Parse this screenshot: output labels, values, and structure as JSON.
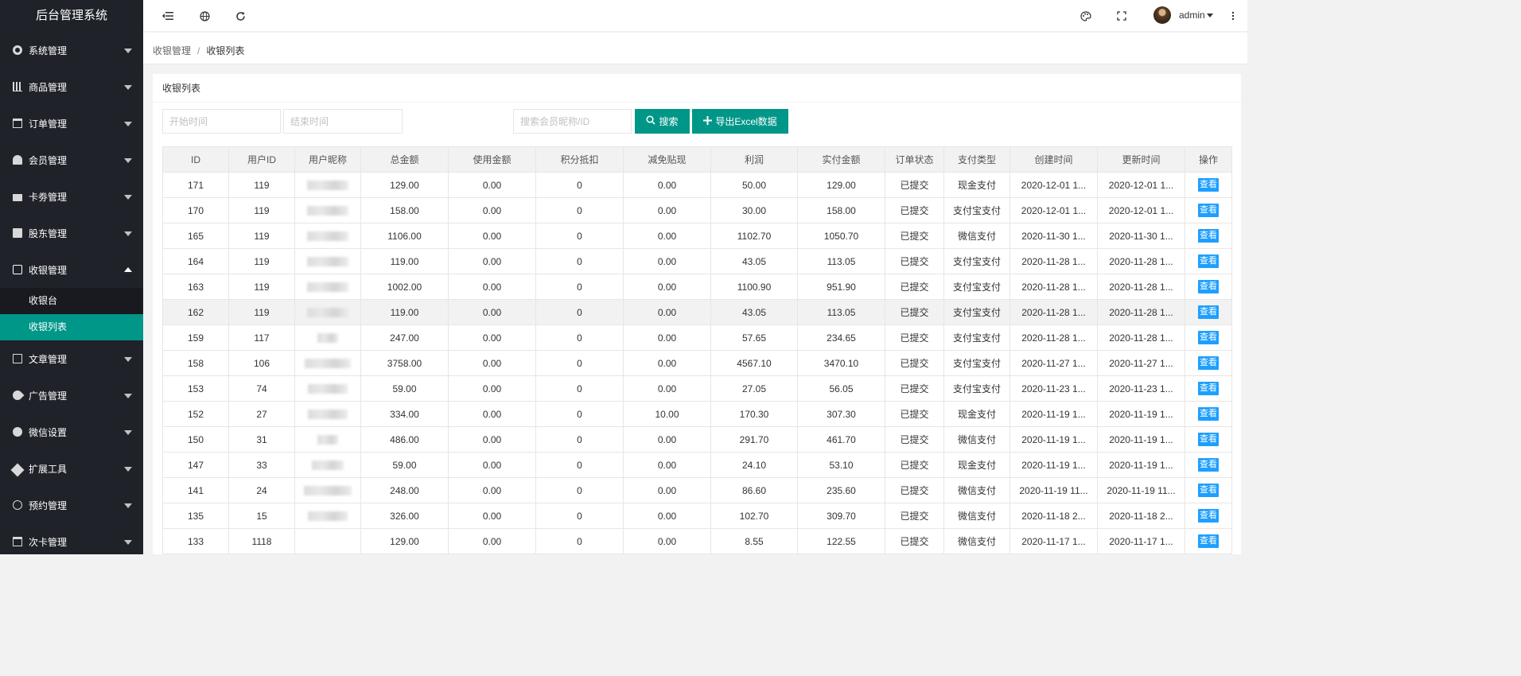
{
  "app": {
    "title": "后台管理系统"
  },
  "sidebar": {
    "items": [
      {
        "label": "系统管理",
        "icon": "gear-icon"
      },
      {
        "label": "商品管理",
        "icon": "bar-chart-icon"
      },
      {
        "label": "订单管理",
        "icon": "calendar-icon"
      },
      {
        "label": "会员管理",
        "icon": "users-icon"
      },
      {
        "label": "卡劵管理",
        "icon": "credit-card-icon"
      },
      {
        "label": "股东管理",
        "icon": "address-book-icon"
      },
      {
        "label": "收银管理",
        "icon": "check-square-icon",
        "expanded": true,
        "children": [
          {
            "label": "收银台"
          },
          {
            "label": "收银列表",
            "active": true
          }
        ]
      },
      {
        "label": "文章管理",
        "icon": "copy-icon"
      },
      {
        "label": "广告管理",
        "icon": "rocket-icon"
      },
      {
        "label": "微信设置",
        "icon": "wechat-icon"
      },
      {
        "label": "扩展工具",
        "icon": "wrench-icon"
      },
      {
        "label": "预约管理",
        "icon": "clock-icon"
      },
      {
        "label": "次卡管理",
        "icon": "calendar-icon"
      }
    ]
  },
  "header": {
    "user": "admin",
    "icons": [
      "shrink-menu-icon",
      "globe-icon",
      "refresh-icon",
      "theme-icon",
      "fullscreen-icon",
      "more-vertical-icon"
    ]
  },
  "breadcrumb": {
    "parent": "收银管理",
    "separator": "/",
    "current": "收银列表"
  },
  "card": {
    "title": "收银列表"
  },
  "filters": {
    "start_placeholder": "开始时间",
    "end_placeholder": "结束时间",
    "search_placeholder": "搜索会员昵称/ID",
    "search_label": "搜索",
    "export_label": "导出Excel数据"
  },
  "table": {
    "columns": [
      "ID",
      "用户ID",
      "用户昵称",
      "总金额",
      "使用金额",
      "积分抵扣",
      "减免贴现",
      "利润",
      "实付金额",
      "订单状态",
      "支付类型",
      "创建时间",
      "更新时间",
      "操作"
    ],
    "action_label": "查看",
    "rows": [
      {
        "id": "171",
        "uid": "119",
        "total": "129.00",
        "used": "0.00",
        "points": "0",
        "discount": "0.00",
        "profit": "50.00",
        "paid": "129.00",
        "status": "已提交",
        "pay": "现金支付",
        "created": "2020-12-01 1...",
        "updated": "2020-12-01 1..."
      },
      {
        "id": "170",
        "uid": "119",
        "total": "158.00",
        "used": "0.00",
        "points": "0",
        "discount": "0.00",
        "profit": "30.00",
        "paid": "158.00",
        "status": "已提交",
        "pay": "支付宝支付",
        "created": "2020-12-01 1...",
        "updated": "2020-12-01 1..."
      },
      {
        "id": "165",
        "uid": "119",
        "total": "1106.00",
        "used": "0.00",
        "points": "0",
        "discount": "0.00",
        "profit": "1102.70",
        "paid": "1050.70",
        "status": "已提交",
        "pay": "微信支付",
        "created": "2020-11-30 1...",
        "updated": "2020-11-30 1..."
      },
      {
        "id": "164",
        "uid": "119",
        "total": "119.00",
        "used": "0.00",
        "points": "0",
        "discount": "0.00",
        "profit": "43.05",
        "paid": "113.05",
        "status": "已提交",
        "pay": "支付宝支付",
        "created": "2020-11-28 1...",
        "updated": "2020-11-28 1..."
      },
      {
        "id": "163",
        "uid": "119",
        "total": "1002.00",
        "used": "0.00",
        "points": "0",
        "discount": "0.00",
        "profit": "1100.90",
        "paid": "951.90",
        "status": "已提交",
        "pay": "支付宝支付",
        "created": "2020-11-28 1...",
        "updated": "2020-11-28 1..."
      },
      {
        "id": "162",
        "uid": "119",
        "total": "119.00",
        "used": "0.00",
        "points": "0",
        "discount": "0.00",
        "profit": "43.05",
        "paid": "113.05",
        "status": "已提交",
        "pay": "支付宝支付",
        "created": "2020-11-28 1...",
        "updated": "2020-11-28 1...",
        "highlight": true
      },
      {
        "id": "159",
        "uid": "117",
        "total": "247.00",
        "used": "0.00",
        "points": "0",
        "discount": "0.00",
        "profit": "57.65",
        "paid": "234.65",
        "status": "已提交",
        "pay": "支付宝支付",
        "created": "2020-11-28 1...",
        "updated": "2020-11-28 1..."
      },
      {
        "id": "158",
        "uid": "106",
        "total": "3758.00",
        "used": "0.00",
        "points": "0",
        "discount": "0.00",
        "profit": "4567.10",
        "paid": "3470.10",
        "status": "已提交",
        "pay": "支付宝支付",
        "created": "2020-11-27 1...",
        "updated": "2020-11-27 1..."
      },
      {
        "id": "153",
        "uid": "74",
        "total": "59.00",
        "used": "0.00",
        "points": "0",
        "discount": "0.00",
        "profit": "27.05",
        "paid": "56.05",
        "status": "已提交",
        "pay": "支付宝支付",
        "created": "2020-11-23 1...",
        "updated": "2020-11-23 1..."
      },
      {
        "id": "152",
        "uid": "27",
        "total": "334.00",
        "used": "0.00",
        "points": "0",
        "discount": "10.00",
        "profit": "170.30",
        "paid": "307.30",
        "status": "已提交",
        "pay": "现金支付",
        "created": "2020-11-19 1...",
        "updated": "2020-11-19 1..."
      },
      {
        "id": "150",
        "uid": "31",
        "total": "486.00",
        "used": "0.00",
        "points": "0",
        "discount": "0.00",
        "profit": "291.70",
        "paid": "461.70",
        "status": "已提交",
        "pay": "微信支付",
        "created": "2020-11-19 1...",
        "updated": "2020-11-19 1..."
      },
      {
        "id": "147",
        "uid": "33",
        "total": "59.00",
        "used": "0.00",
        "points": "0",
        "discount": "0.00",
        "profit": "24.10",
        "paid": "53.10",
        "status": "已提交",
        "pay": "现金支付",
        "created": "2020-11-19 1...",
        "updated": "2020-11-19 1..."
      },
      {
        "id": "141",
        "uid": "24",
        "total": "248.00",
        "used": "0.00",
        "points": "0",
        "discount": "0.00",
        "profit": "86.60",
        "paid": "235.60",
        "status": "已提交",
        "pay": "微信支付",
        "created": "2020-11-19 11...",
        "updated": "2020-11-19 11..."
      },
      {
        "id": "135",
        "uid": "15",
        "total": "326.00",
        "used": "0.00",
        "points": "0",
        "discount": "0.00",
        "profit": "102.70",
        "paid": "309.70",
        "status": "已提交",
        "pay": "微信支付",
        "created": "2020-11-18 2...",
        "updated": "2020-11-18 2..."
      },
      {
        "id": "133",
        "uid": "1118",
        "total": "129.00",
        "used": "0.00",
        "points": "0",
        "discount": "0.00",
        "profit": "8.55",
        "paid": "122.55",
        "status": "已提交",
        "pay": "微信支付",
        "created": "2020-11-17 1...",
        "updated": "2020-11-17 1..."
      }
    ]
  },
  "colors": {
    "sidebar_bg": "#20222a",
    "accent": "#009688",
    "view_button": "#1e9fff"
  }
}
